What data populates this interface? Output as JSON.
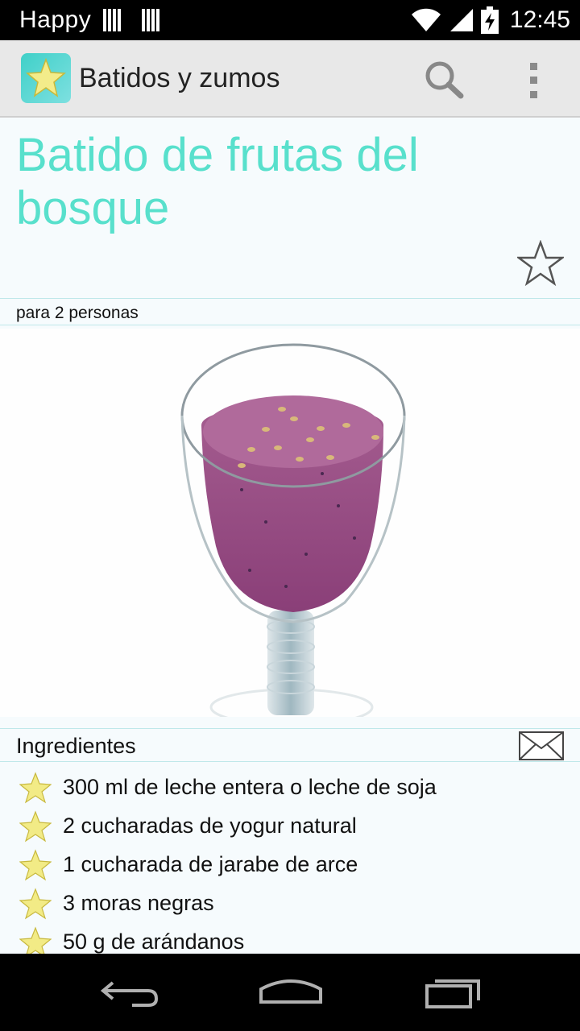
{
  "status_bar": {
    "carrier": "Happy",
    "time": "12:45"
  },
  "action_bar": {
    "title": "Batidos y zumos",
    "icons": [
      "app-star-icon",
      "search-icon",
      "overflow-menu-icon"
    ]
  },
  "recipe": {
    "title": "Batido de frutas del bosque",
    "servings": "para 2 personas",
    "photo": "purple-berry-smoothie-in-glass"
  },
  "ingredients": {
    "header": "Ingredientes",
    "items": [
      "300 ml de leche entera o leche de soja",
      "2 cucharadas de yogur natural",
      "1 cucharada de jarabe de arce",
      "3  moras negras",
      "50 g de arándanos"
    ]
  },
  "colors": {
    "title_accent": "#58e0cc",
    "divider": "#bfe8ea",
    "action_bar": "#e8e8e8",
    "smoothie": "#9a4f86"
  }
}
